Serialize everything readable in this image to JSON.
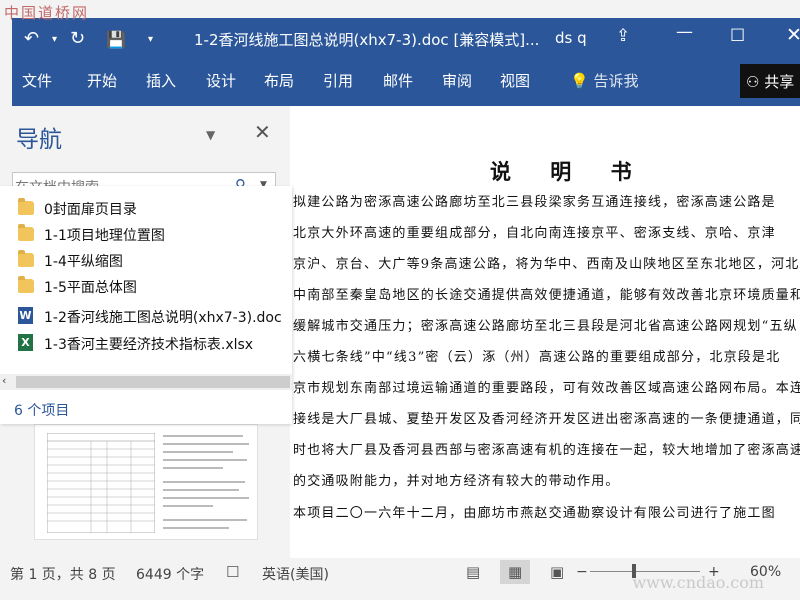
{
  "watermark": {
    "top": "中国道桥网",
    "bottom": "www.cndao.com"
  },
  "quick_access": {
    "undo_icon": "↶",
    "undo_drop": "▾",
    "redo_icon": "↻",
    "save_icon": "💾",
    "customize_icon": "▾"
  },
  "window": {
    "title": "1-2香河线施工图总说明(xhx7-3).doc [兼容模式]...",
    "user": "ds q",
    "ribbon_display_icon": "⇪",
    "minimize_icon": "—",
    "maximize_icon": "☐",
    "close_icon": "✕"
  },
  "ribbon": {
    "tabs": [
      "文件",
      "开始",
      "插入",
      "设计",
      "布局",
      "引用",
      "邮件",
      "审阅",
      "视图"
    ],
    "tell_me": "💡 告诉我",
    "share": "⚇ 共享"
  },
  "nav": {
    "title": "导航",
    "dropdown_icon": "▼",
    "close_icon": "✕",
    "search_placeholder": "在文档中搜索",
    "search_icon": "⚲",
    "search_drop": "▼"
  },
  "files": {
    "items": [
      {
        "name": "0封面扉页目录",
        "type": "folder"
      },
      {
        "name": "1-1项目地理位置图",
        "type": "folder"
      },
      {
        "name": "1-4平纵缩图",
        "type": "folder"
      },
      {
        "name": "1-5平面总体图",
        "type": "folder"
      },
      {
        "name": "1-2香河线施工图总说明(xhx7-3).doc",
        "type": "word"
      },
      {
        "name": "1-3香河主要经济技术指标表.xlsx",
        "type": "excel"
      }
    ],
    "word_badge": "W",
    "excel_badge": "X",
    "scroll_left_icon": "‹",
    "count": "6 个项目"
  },
  "document": {
    "heading": "说 明 书",
    "lines": [
      "    拟建公路为密涿高速公路廊坊至北三县段梁家务互通连接线，密涿高速公路是",
      "北京大外环高速的重要组成部分，自北向南连接京平、密涿支线、京哈、京津",
      "京沪、京台、大广等9条高速公路，将为华中、西南及山陕地区至东北地区，河北",
      "中南部至秦皇岛地区的长途交通提供高效便捷通道，能够有效改善北京环境质量和",
      "缓解城市交通压力；密涿高速公路廊坊至北三县段是河北省高速公路网规划“五纵",
      "六横七条线”中“线3”密（云）涿（州）高速公路的重要组成部分，北京段是北",
      "京市规划东南部过境运输通道的重要路段，可有效改善区域高速公路网布局。本连",
      "接线是大厂县城、夏垫开发区及香河经济开发区进出密涿高速的一条便捷通道，同",
      "时也将大厂县及香河县西部与密涿高速有机的连接在一起，较大地增加了密涿高速",
      "的交通吸附能力，并对地方经济有较大的带动作用。",
      "    本项目二〇一六年十二月，由廊坊市燕赵交通勘察设计有限公司进行了施工图"
    ]
  },
  "status": {
    "page": "第 1 页，共 8 页",
    "words": "6449 个字",
    "proof_icon": "☐",
    "language": "英语(美国)",
    "read_icon": "▤",
    "print_icon": "▦",
    "web_icon": "▣",
    "zoom_out": "−",
    "zoom_in": "+",
    "zoom": "60%",
    "zoom_level": 0.6
  },
  "colors": {
    "accent": "#2b579a",
    "folder": "#f2c55c",
    "excel": "#217346"
  }
}
